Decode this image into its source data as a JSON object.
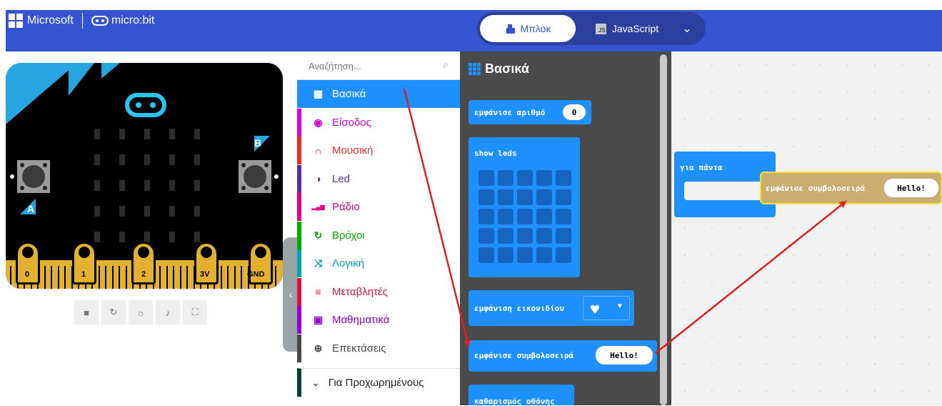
{
  "header": {
    "microsoft": "Microsoft",
    "microbit": "micro:bit",
    "blocks_tab": "Μπλοκ",
    "javascript_tab": "JavaScript",
    "js_icon_text": "JS"
  },
  "simulator": {
    "button_a": "A",
    "button_b": "B",
    "pins": [
      "0",
      "1",
      "2",
      "3V",
      "GND"
    ]
  },
  "toolbox": {
    "search_placeholder": "Αναζήτηση...",
    "categories": [
      {
        "label": "Βασικά",
        "color": "#1e90ff",
        "icon": "grid-icon"
      },
      {
        "label": "Είσοδος",
        "color": "#d400d4",
        "icon": "target-icon"
      },
      {
        "label": "Μουσική",
        "color": "#e63022",
        "icon": "headphones-icon"
      },
      {
        "label": "Led",
        "color": "#5c2d91",
        "icon": "toggle-icon"
      },
      {
        "label": "Ράδιο",
        "color": "#e3008c",
        "icon": "signal-icon"
      },
      {
        "label": "Βρόχοι",
        "color": "#00aa00",
        "icon": "loop-icon"
      },
      {
        "label": "Λογική",
        "color": "#00a4a6",
        "icon": "shuffle-icon"
      },
      {
        "label": "Μεταβλητές",
        "color": "#dc143c",
        "icon": "list-icon"
      },
      {
        "label": "Μαθηματικά",
        "color": "#9400d3",
        "icon": "calculator-icon"
      },
      {
        "label": "Επεκτάσεις",
        "color": "#4b4a4b",
        "icon": "plus-circle-icon"
      }
    ],
    "advanced": "Για Προχωρημένους"
  },
  "flyout": {
    "title": "Βασικά",
    "show_number": "εμφάνισε αριθμό",
    "show_number_value": "0",
    "show_leds": "show leds",
    "show_icon": "εμφάνιση εικονιδίου",
    "show_string": "εμφάνισε συμβολοσειρά",
    "show_string_value": "Hello!",
    "clear_screen": "καθαρισμός οθόνης"
  },
  "workspace": {
    "forever": "για πάντα",
    "dragged_block": "εμφάνισε συμβολοσειρά",
    "dragged_value": "Hello!"
  },
  "colors": {
    "header": "#3454d1",
    "basic": "#1e90ff",
    "arrow": "#e02020"
  }
}
